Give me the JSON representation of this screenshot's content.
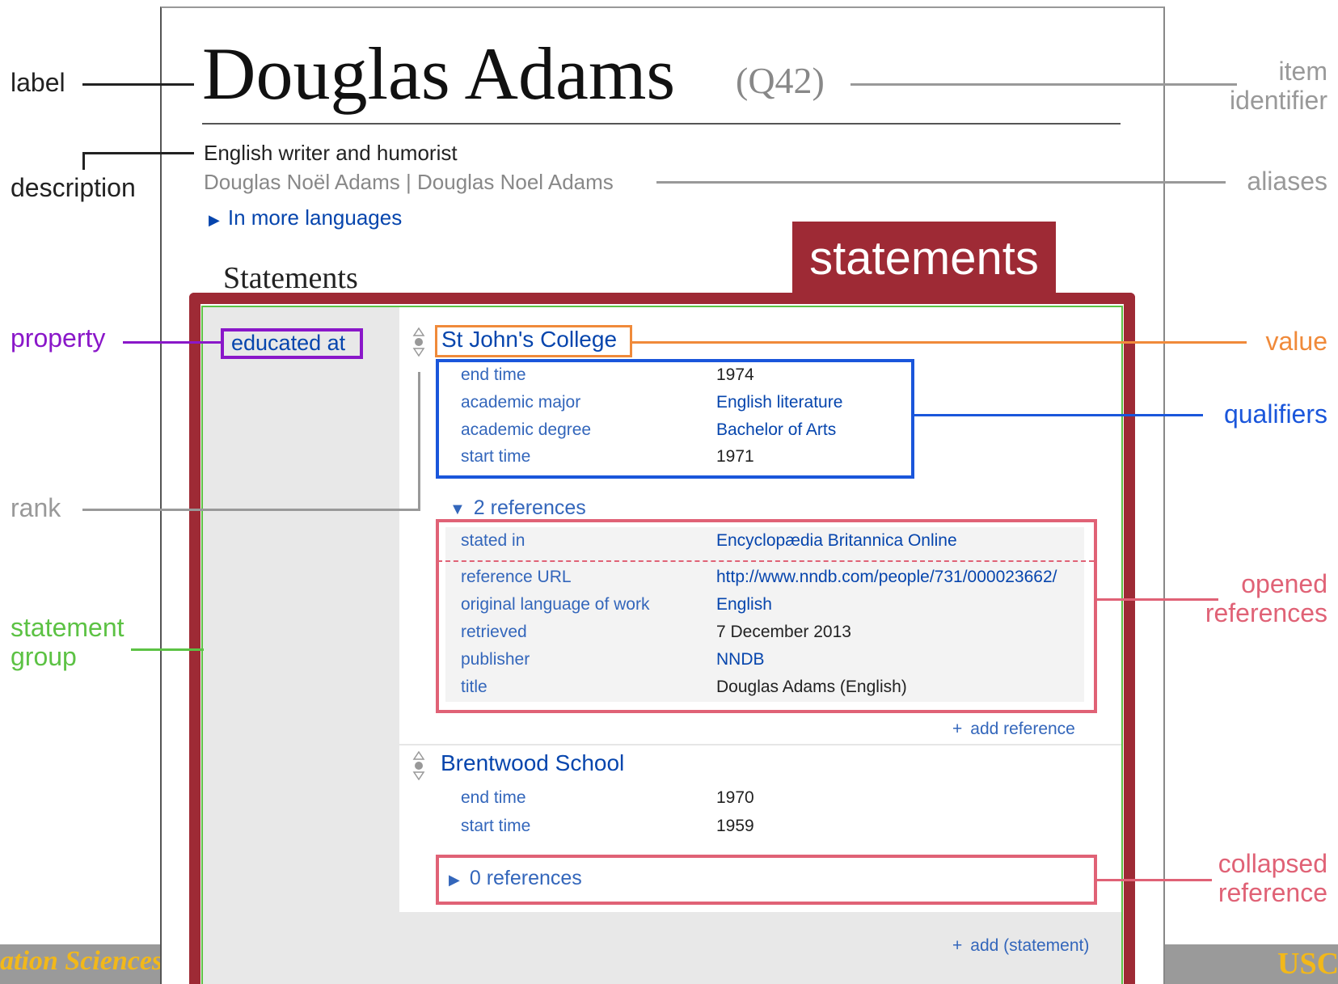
{
  "item": {
    "label": "Douglas Adams",
    "identifier": "(Q42)",
    "description": "English writer and humorist",
    "aliases": "Douglas Noël Adams | Douglas Noel Adams",
    "more_languages": "In more languages"
  },
  "statements_heading": "Statements",
  "statements_banner": "statements",
  "statement_group": {
    "property": "educated at",
    "statements": [
      {
        "value": "St John's College",
        "qualifiers": [
          {
            "label": "end time",
            "value": "1974"
          },
          {
            "label": "academic major",
            "value": "English literature"
          },
          {
            "label": "academic degree",
            "value": "Bachelor of Arts"
          },
          {
            "label": "start time",
            "value": "1971"
          }
        ],
        "references_toggle": "2 references",
        "references": [
          [
            {
              "label": "stated in",
              "value": "Encyclopædia Britannica Online"
            }
          ],
          [
            {
              "label": "reference URL",
              "value": "http://www.nndb.com/people/731/000023662/"
            },
            {
              "label": "original language of work",
              "value": "English"
            },
            {
              "label": "retrieved",
              "value": "7 December 2013"
            },
            {
              "label": "publisher",
              "value": "NNDB"
            },
            {
              "label": "title",
              "value": "Douglas Adams (English)"
            }
          ]
        ],
        "add_reference": "add reference"
      },
      {
        "value": "Brentwood School",
        "qualifiers": [
          {
            "label": "end time",
            "value": "1970"
          },
          {
            "label": "start time",
            "value": "1959"
          }
        ],
        "references_toggle": "0 references"
      }
    ],
    "add_statement": "add (statement)"
  },
  "annotations": {
    "label": "label",
    "description": "description",
    "property": "property",
    "rank": "rank",
    "statement_group_1": "statement",
    "statement_group_2": "group",
    "item_identifier_1": "item",
    "item_identifier_2": "identifier",
    "aliases": "aliases",
    "value": "value",
    "qualifiers": "qualifiers",
    "opened_references_1": "opened",
    "opened_references_2": "references",
    "collapsed_reference_1": "collapsed",
    "collapsed_reference_2": "reference"
  },
  "footer": {
    "left": "ation Sciences",
    "right": "USC"
  },
  "colors": {
    "banner": "#9e2a35",
    "statement_group": "#5cc244",
    "property": "#8a17c9",
    "value": "#f08a3a",
    "qualifiers": "#1a56db",
    "references": "#e06276",
    "rank": "#999999",
    "footer_bar": "#9a9a9a",
    "footer_text": "#f2b81a"
  }
}
